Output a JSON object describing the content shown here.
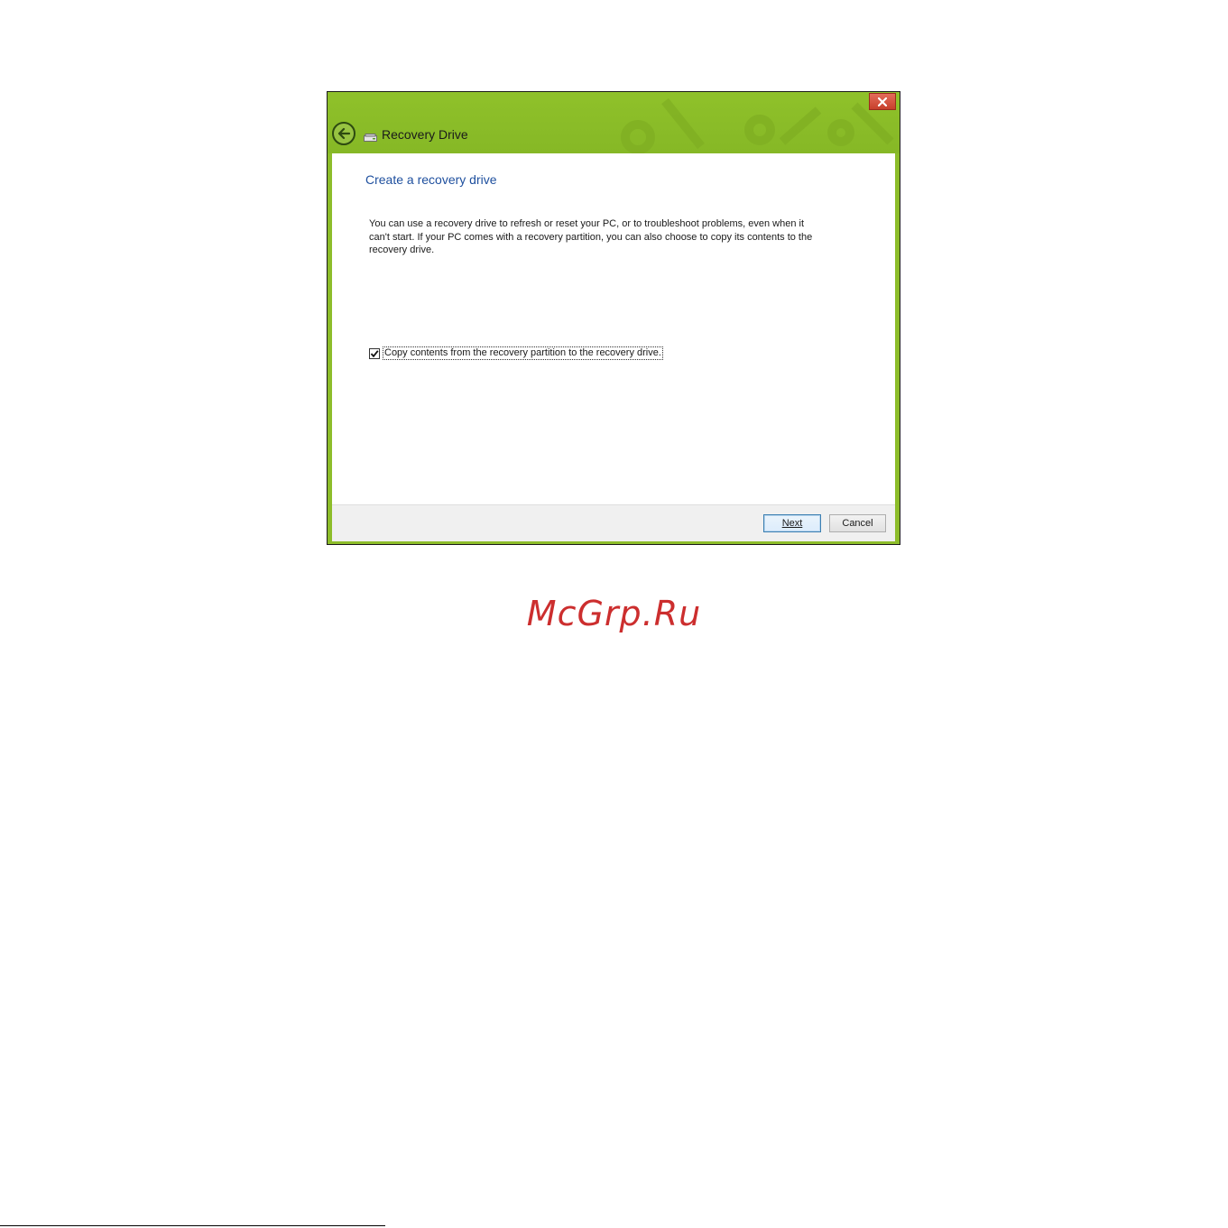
{
  "window": {
    "title": "Recovery Drive",
    "close_label": "×",
    "accent_color": "#8dbd2a"
  },
  "content": {
    "heading": "Create a recovery drive",
    "description": "You can use a recovery drive to refresh or reset your PC, or to troubleshoot problems, even when it can't start. If your PC comes with a recovery partition, you can also choose to copy its contents to the recovery drive.",
    "checkbox": {
      "label": "Copy contents from the recovery partition to the recovery drive.",
      "checked": true
    }
  },
  "footer": {
    "next_label": "Next",
    "cancel_label": "Cancel"
  },
  "watermark": {
    "text": "McGrp.Ru",
    "color": "#cc2e2e"
  },
  "icons": {
    "back": "back-arrow-icon",
    "app": "drive-icon",
    "close": "close-icon",
    "check": "checkmark-icon"
  }
}
